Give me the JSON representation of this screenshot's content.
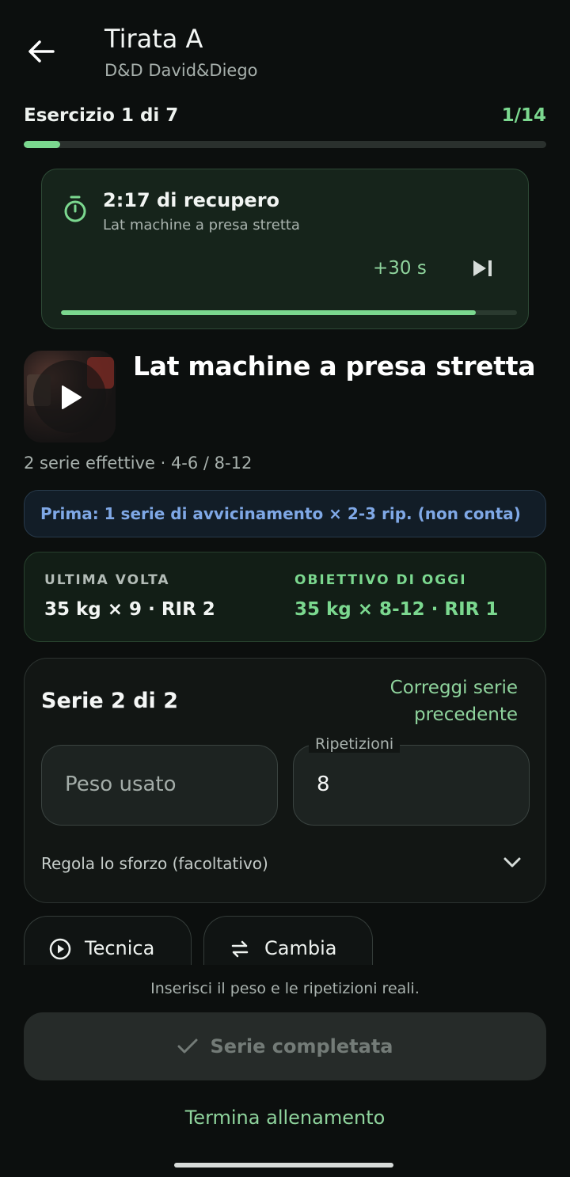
{
  "header": {
    "title": "Tirata A",
    "subtitle": "D&D David&Diego"
  },
  "progress": {
    "exercise_label": "Esercizio 1 di 7",
    "counter": "1/14",
    "fraction": 0.07
  },
  "rest": {
    "title": "2:17 di recupero",
    "exercise": "Lat machine a presa stretta",
    "add_time_label": "+30 s",
    "progress_fraction": 0.91
  },
  "exercise": {
    "name": "Lat machine a presa stretta",
    "meta": "2 serie effettive · 4-6 / 8-12",
    "warmup_note": "Prima: 1 serie di avvicinamento × 2-3 rip. (non conta)"
  },
  "summary": {
    "last_label": "ULTIMA VOLTA",
    "last_value": "35 kg × 9 · RIR 2",
    "goal_label": "OBIETTIVO DI OGGI",
    "goal_value": "35 kg × 8-12 · RIR 1"
  },
  "set_card": {
    "title": "Serie 2 di 2",
    "fix_previous_line1": "Correggi serie",
    "fix_previous_line2": "precedente",
    "weight_placeholder": "Peso usato",
    "reps_label": "Ripetizioni",
    "reps_value": "8",
    "effort_label": "Regola lo sforzo (facoltativo)"
  },
  "chips": {
    "technique": "Tecnica",
    "swap": "Cambia"
  },
  "hint": "Inserisci il peso e le ripetizioni reali.",
  "complete_button": "Serie completata",
  "end_workout": "Termina allenamento",
  "colors": {
    "accent_green": "#7bd88f",
    "info_blue": "#7fa8e6",
    "background": "#0c0f0e"
  }
}
